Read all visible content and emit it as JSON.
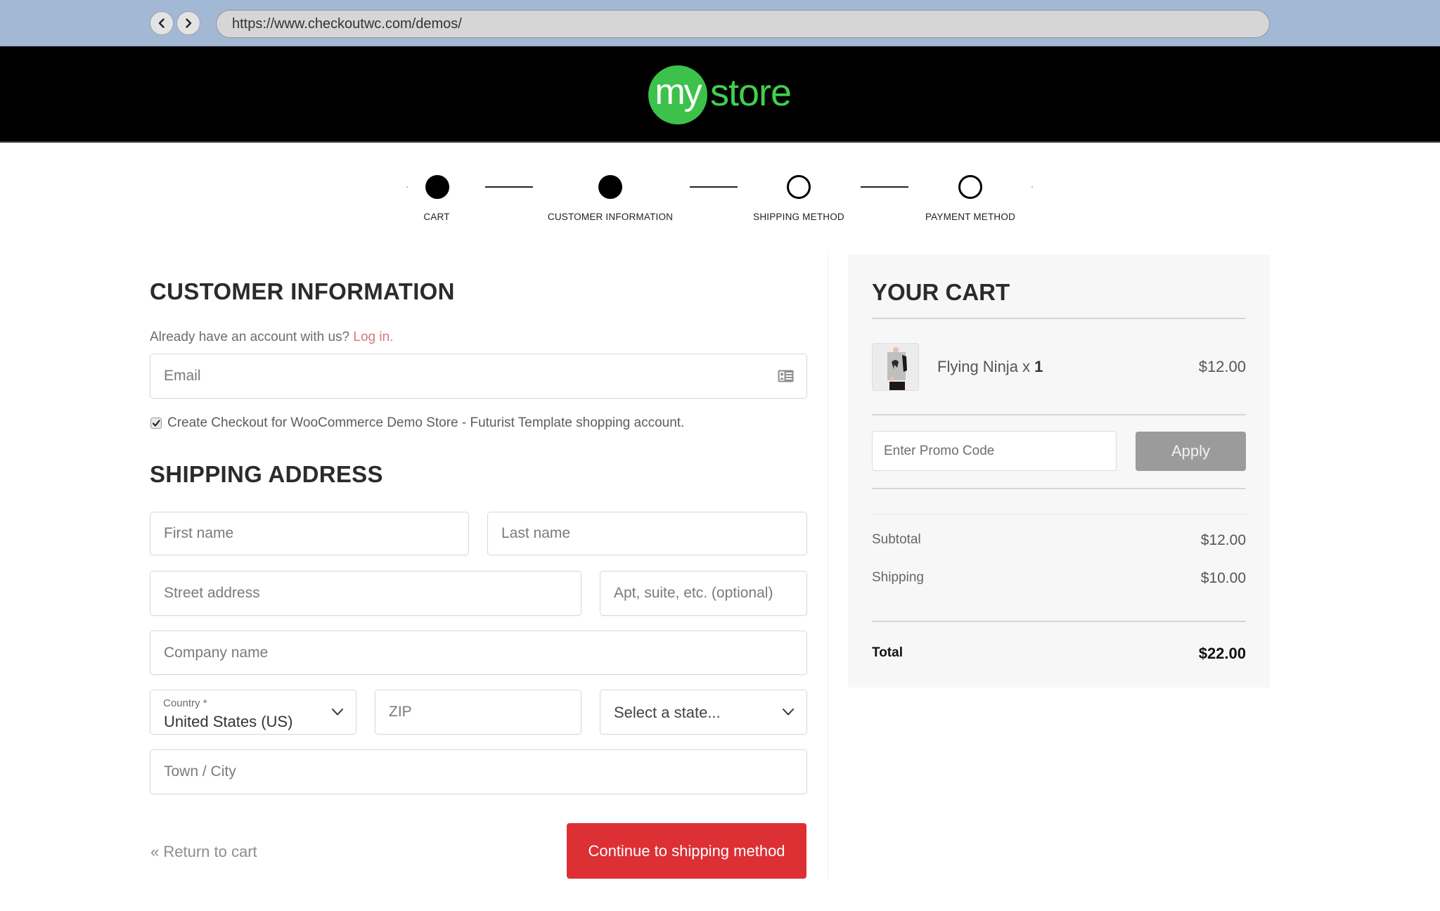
{
  "browser": {
    "back_icon": "chevron-left-icon",
    "forward_icon": "chevron-right-icon",
    "url": "https://www.checkoutwc.com/demos/"
  },
  "header": {
    "logo_circle_text": "my",
    "logo_text": "store",
    "brand_color": "#3cc24a"
  },
  "steps": [
    {
      "label": "CART",
      "state": "complete"
    },
    {
      "label": "CUSTOMER INFORMATION",
      "state": "current"
    },
    {
      "label": "SHIPPING METHOD",
      "state": "pending"
    },
    {
      "label": "PAYMENT METHOD",
      "state": "pending"
    }
  ],
  "customer_info": {
    "title": "CUSTOMER INFORMATION",
    "account_prompt": "Already have an account with us?",
    "login_link": "Log in.",
    "email_placeholder": "Email",
    "email_icon": "contact-card-icon",
    "create_account_label": "Create Checkout for WooCommerce Demo Store - Futurist Template shopping account.",
    "create_account_checked": true
  },
  "shipping_address": {
    "title": "SHIPPING ADDRESS",
    "first_name_placeholder": "First name",
    "last_name_placeholder": "Last name",
    "street_placeholder": "Street address",
    "apt_placeholder": "Apt, suite, etc. (optional)",
    "company_placeholder": "Company name",
    "country_label": "Country *",
    "country_value": "United States (US)",
    "zip_placeholder": "ZIP",
    "state_placeholder": "Select a state...",
    "city_placeholder": "Town / City"
  },
  "actions": {
    "return_link": "« Return to cart",
    "continue_button": "Continue to shipping method",
    "continue_color": "#dc3034"
  },
  "cart": {
    "title": "YOUR CART",
    "items": [
      {
        "name": "Flying Ninja x ",
        "qty": "1",
        "price": "$12.00"
      }
    ],
    "promo_placeholder": "Enter Promo Code",
    "apply_button": "Apply",
    "subtotal_label": "Subtotal",
    "subtotal_value": "$12.00",
    "shipping_label": "Shipping",
    "shipping_value": "$10.00",
    "total_label": "Total",
    "total_value": "$22.00"
  }
}
